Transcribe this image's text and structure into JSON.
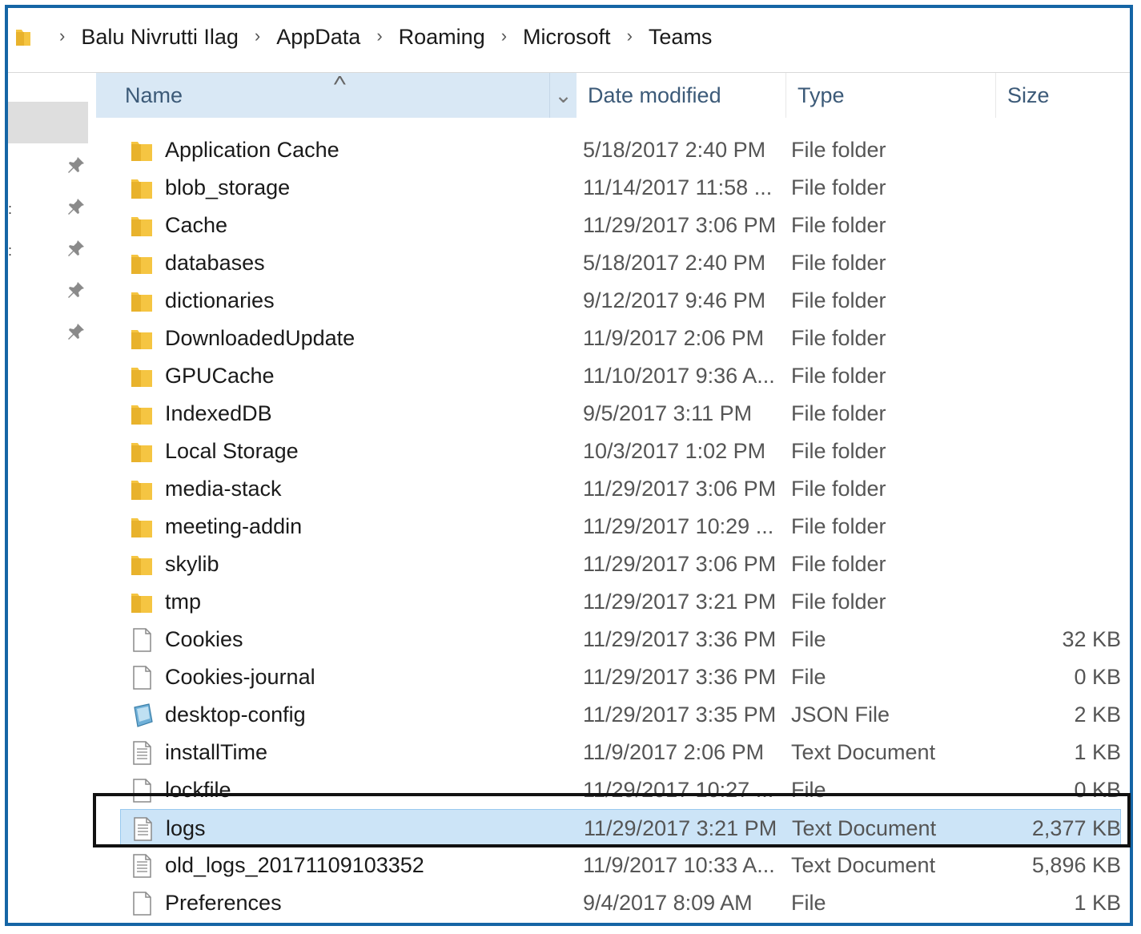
{
  "breadcrumb": [
    "Balu Nivrutti Ilag",
    "AppData",
    "Roaming",
    "Microsoft",
    "Teams"
  ],
  "columns": {
    "name": "Name",
    "date": "Date modified",
    "type": "Type",
    "size": "Size"
  },
  "rows": [
    {
      "name": "Application Cache",
      "date": "5/18/2017 2:40 PM",
      "type": "File folder",
      "size": "",
      "icon": "folder-icon"
    },
    {
      "name": "blob_storage",
      "date": "11/14/2017 11:58 ...",
      "type": "File folder",
      "size": "",
      "icon": "folder-icon"
    },
    {
      "name": "Cache",
      "date": "11/29/2017 3:06 PM",
      "type": "File folder",
      "size": "",
      "icon": "folder-icon"
    },
    {
      "name": "databases",
      "date": "5/18/2017 2:40 PM",
      "type": "File folder",
      "size": "",
      "icon": "folder-icon"
    },
    {
      "name": "dictionaries",
      "date": "9/12/2017 9:46 PM",
      "type": "File folder",
      "size": "",
      "icon": "folder-icon"
    },
    {
      "name": "DownloadedUpdate",
      "date": "11/9/2017 2:06 PM",
      "type": "File folder",
      "size": "",
      "icon": "folder-icon"
    },
    {
      "name": "GPUCache",
      "date": "11/10/2017 9:36 A...",
      "type": "File folder",
      "size": "",
      "icon": "folder-icon"
    },
    {
      "name": "IndexedDB",
      "date": "9/5/2017 3:11 PM",
      "type": "File folder",
      "size": "",
      "icon": "folder-icon"
    },
    {
      "name": "Local Storage",
      "date": "10/3/2017 1:02 PM",
      "type": "File folder",
      "size": "",
      "icon": "folder-icon"
    },
    {
      "name": "media-stack",
      "date": "11/29/2017 3:06 PM",
      "type": "File folder",
      "size": "",
      "icon": "folder-icon"
    },
    {
      "name": "meeting-addin",
      "date": "11/29/2017 10:29 ...",
      "type": "File folder",
      "size": "",
      "icon": "folder-icon"
    },
    {
      "name": "skylib",
      "date": "11/29/2017 3:06 PM",
      "type": "File folder",
      "size": "",
      "icon": "folder-icon"
    },
    {
      "name": "tmp",
      "date": "11/29/2017 3:21 PM",
      "type": "File folder",
      "size": "",
      "icon": "folder-icon"
    },
    {
      "name": "Cookies",
      "date": "11/29/2017 3:36 PM",
      "type": "File",
      "size": "32 KB",
      "icon": "file-icon"
    },
    {
      "name": "Cookies-journal",
      "date": "11/29/2017 3:36 PM",
      "type": "File",
      "size": "0 KB",
      "icon": "file-icon"
    },
    {
      "name": "desktop-config",
      "date": "11/29/2017 3:35 PM",
      "type": "JSON File",
      "size": "2 KB",
      "icon": "json-file-icon"
    },
    {
      "name": "installTime",
      "date": "11/9/2017 2:06 PM",
      "type": "Text Document",
      "size": "1 KB",
      "icon": "text-file-icon"
    },
    {
      "name": "lockfile",
      "date": "11/29/2017 10:27 ...",
      "type": "File",
      "size": "0 KB",
      "icon": "file-icon"
    },
    {
      "name": "logs",
      "date": "11/29/2017 3:21 PM",
      "type": "Text Document",
      "size": "2,377 KB",
      "icon": "text-file-icon",
      "selected": true
    },
    {
      "name": "old_logs_20171109103352",
      "date": "11/9/2017 10:33 A...",
      "type": "Text Document",
      "size": "5,896 KB",
      "icon": "text-file-icon"
    },
    {
      "name": "Preferences",
      "date": "9/4/2017 8:09 AM",
      "type": "File",
      "size": "1 KB",
      "icon": "file-icon"
    }
  ]
}
